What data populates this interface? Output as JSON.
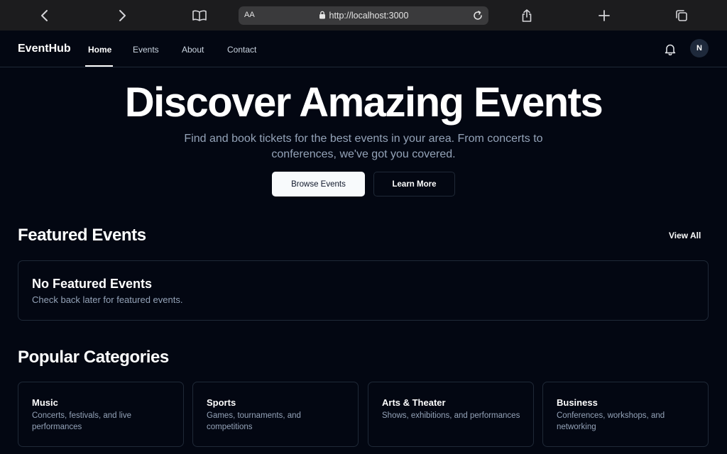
{
  "browser": {
    "text_size_label": "AA",
    "url": "http://localhost:3000"
  },
  "header": {
    "brand": "EventHub",
    "nav": [
      {
        "label": "Home",
        "active": true
      },
      {
        "label": "Events",
        "active": false
      },
      {
        "label": "About",
        "active": false
      },
      {
        "label": "Contact",
        "active": false
      }
    ],
    "avatar_initial": "N"
  },
  "hero": {
    "title": "Discover Amazing Events",
    "subtitle": "Find and book tickets for the best events in your area. From concerts to conferences, we've got you covered.",
    "primary_button": "Browse Events",
    "secondary_button": "Learn More"
  },
  "featured": {
    "title": "Featured Events",
    "view_all": "View All",
    "empty_title": "No Featured Events",
    "empty_message": "Check back later for featured events."
  },
  "categories": {
    "title": "Popular Categories",
    "items": [
      {
        "name": "Music",
        "description": "Concerts, festivals, and live performances"
      },
      {
        "name": "Sports",
        "description": "Games, tournaments, and competitions"
      },
      {
        "name": "Arts & Theater",
        "description": "Shows, exhibitions, and performances"
      },
      {
        "name": "Business",
        "description": "Conferences, workshops, and networking"
      }
    ]
  },
  "colors": {
    "background": "#030712",
    "border": "#1f2937",
    "muted_text": "#94a3b8",
    "primary_button_bg": "#f8fafc"
  },
  "icons": [
    "back-icon",
    "forward-icon",
    "reader-icon",
    "lock-icon",
    "reload-icon",
    "share-icon",
    "new-tab-icon",
    "tabs-icon",
    "bell-icon"
  ]
}
